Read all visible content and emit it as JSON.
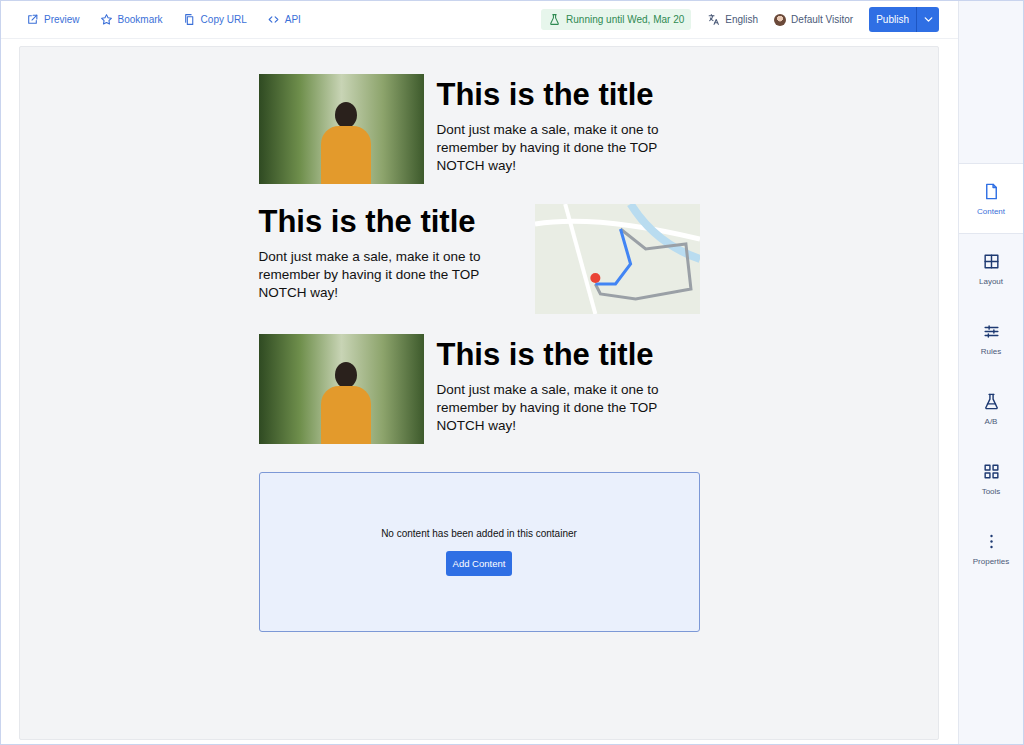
{
  "toolbar": {
    "actions": [
      {
        "label": "Preview"
      },
      {
        "label": "Bookmark"
      },
      {
        "label": "Copy URL"
      },
      {
        "label": "API"
      }
    ],
    "status": "Running until Wed, Mar 20",
    "language": "English",
    "visitor": "Default Visitor",
    "publish": "Publish"
  },
  "sidebar": {
    "items": [
      {
        "label": "Content",
        "selected": true
      },
      {
        "label": "Layout",
        "selected": false
      },
      {
        "label": "Rules",
        "selected": false
      },
      {
        "label": "A/B",
        "selected": false
      },
      {
        "label": "Tools",
        "selected": false
      },
      {
        "label": "Properties",
        "selected": false
      }
    ]
  },
  "canvas": {
    "blocks": [
      {
        "kind": "image-left",
        "media": "photo",
        "title": "This is the title",
        "text": "Dont just make a sale, make it one to remember by having it done the TOP NOTCH way!"
      },
      {
        "kind": "image-right",
        "media": "map",
        "title": "This is the title",
        "text": "Dont just make a sale, make it one to remember by having it done the TOP NOTCH way!"
      },
      {
        "kind": "image-left",
        "media": "photo",
        "title": "This is the title",
        "text": "Dont just make a sale, make it one to remember by having it done the TOP NOTCH way!"
      }
    ],
    "empty_container": {
      "message": "No content has been added in this container",
      "button": "Add Content"
    }
  }
}
